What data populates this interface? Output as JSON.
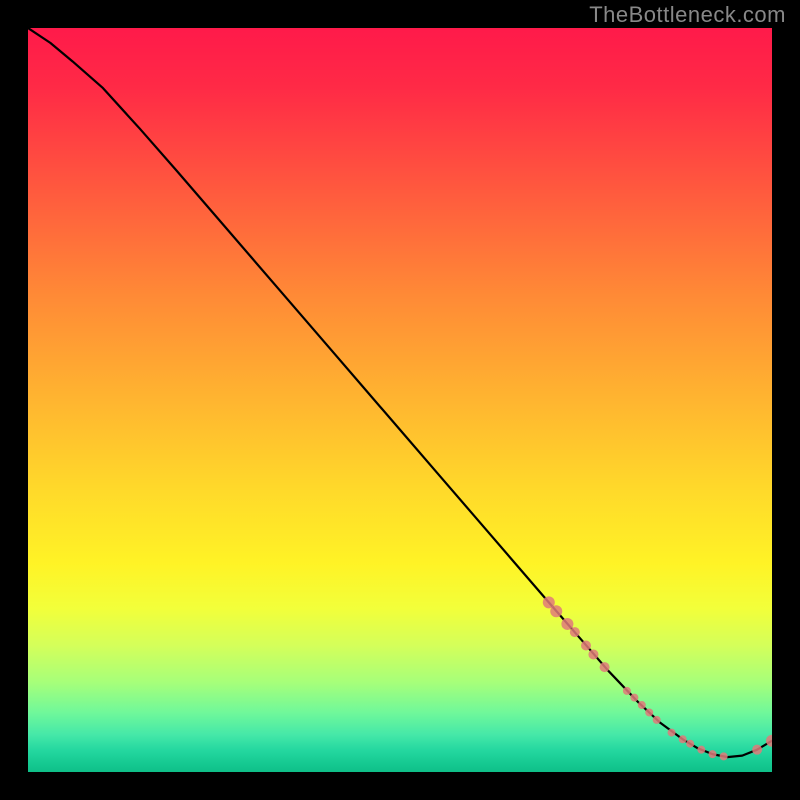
{
  "watermark": "TheBottleneck.com",
  "colors": {
    "background": "#000000",
    "watermark": "#888888",
    "curve": "#000000",
    "marker": "#e07a7a"
  },
  "chart_data": {
    "type": "line",
    "title": "",
    "xlabel": "",
    "ylabel": "",
    "xlim": [
      0,
      100
    ],
    "ylim": [
      0,
      100
    ],
    "grid": false,
    "legend": false,
    "series": [
      {
        "name": "bottleneck-curve",
        "x": [
          0,
          3,
          6,
          10,
          15,
          20,
          25,
          30,
          35,
          40,
          45,
          50,
          55,
          60,
          65,
          70,
          74,
          78,
          82,
          85,
          88,
          90,
          92,
          94,
          96,
          98,
          100
        ],
        "y": [
          100,
          98,
          95.5,
          92,
          86.5,
          80.8,
          75,
          69.2,
          63.4,
          57.6,
          51.8,
          46,
          40.2,
          34.4,
          28.6,
          22.8,
          18.2,
          13.6,
          9.4,
          6.6,
          4.4,
          3.2,
          2.4,
          2.0,
          2.2,
          3.0,
          4.2
        ]
      }
    ],
    "markers": {
      "name": "highlighted-points",
      "color": "#e07a7a",
      "points": [
        {
          "x": 70.0,
          "y": 22.8,
          "r": 6
        },
        {
          "x": 71.0,
          "y": 21.6,
          "r": 6
        },
        {
          "x": 72.5,
          "y": 19.9,
          "r": 6
        },
        {
          "x": 73.5,
          "y": 18.8,
          "r": 5
        },
        {
          "x": 75.0,
          "y": 17.0,
          "r": 5
        },
        {
          "x": 76.0,
          "y": 15.8,
          "r": 5
        },
        {
          "x": 77.5,
          "y": 14.1,
          "r": 5
        },
        {
          "x": 80.5,
          "y": 10.9,
          "r": 4
        },
        {
          "x": 81.5,
          "y": 10.0,
          "r": 4
        },
        {
          "x": 82.5,
          "y": 9.0,
          "r": 4
        },
        {
          "x": 83.5,
          "y": 8.0,
          "r": 4
        },
        {
          "x": 84.5,
          "y": 7.0,
          "r": 4
        },
        {
          "x": 86.5,
          "y": 5.3,
          "r": 4
        },
        {
          "x": 88.0,
          "y": 4.4,
          "r": 4
        },
        {
          "x": 89.0,
          "y": 3.8,
          "r": 4
        },
        {
          "x": 90.5,
          "y": 3.0,
          "r": 4
        },
        {
          "x": 92.0,
          "y": 2.4,
          "r": 4
        },
        {
          "x": 93.5,
          "y": 2.1,
          "r": 4
        },
        {
          "x": 98.0,
          "y": 3.0,
          "r": 5
        },
        {
          "x": 100.0,
          "y": 4.2,
          "r": 6
        }
      ]
    }
  }
}
